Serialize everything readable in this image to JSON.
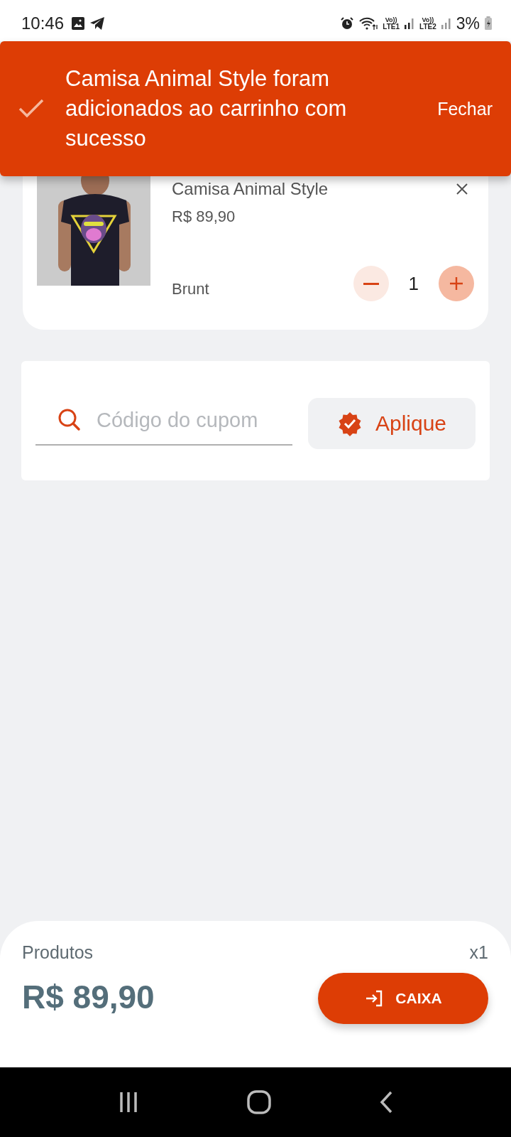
{
  "status_bar": {
    "time": "10:46",
    "volte_1": "Vo))",
    "sim_1": "LTE1",
    "volte_2": "Vo))",
    "sim_2": "LTE2",
    "battery": "3%"
  },
  "snackbar": {
    "message": "Camisa Animal Style foram adicionados ao carrinho com sucesso",
    "action": "Fechar"
  },
  "cart_item": {
    "title": "Camisa Animal Style",
    "price": "R$ 89,90",
    "brand": "Brunt",
    "quantity": "1"
  },
  "coupon": {
    "placeholder": "Código do cupom",
    "button": "Aplique"
  },
  "summary": {
    "label": "Produtos",
    "count": "x1",
    "total": "R$ 89,90",
    "checkout_button": "CAIXA"
  }
}
